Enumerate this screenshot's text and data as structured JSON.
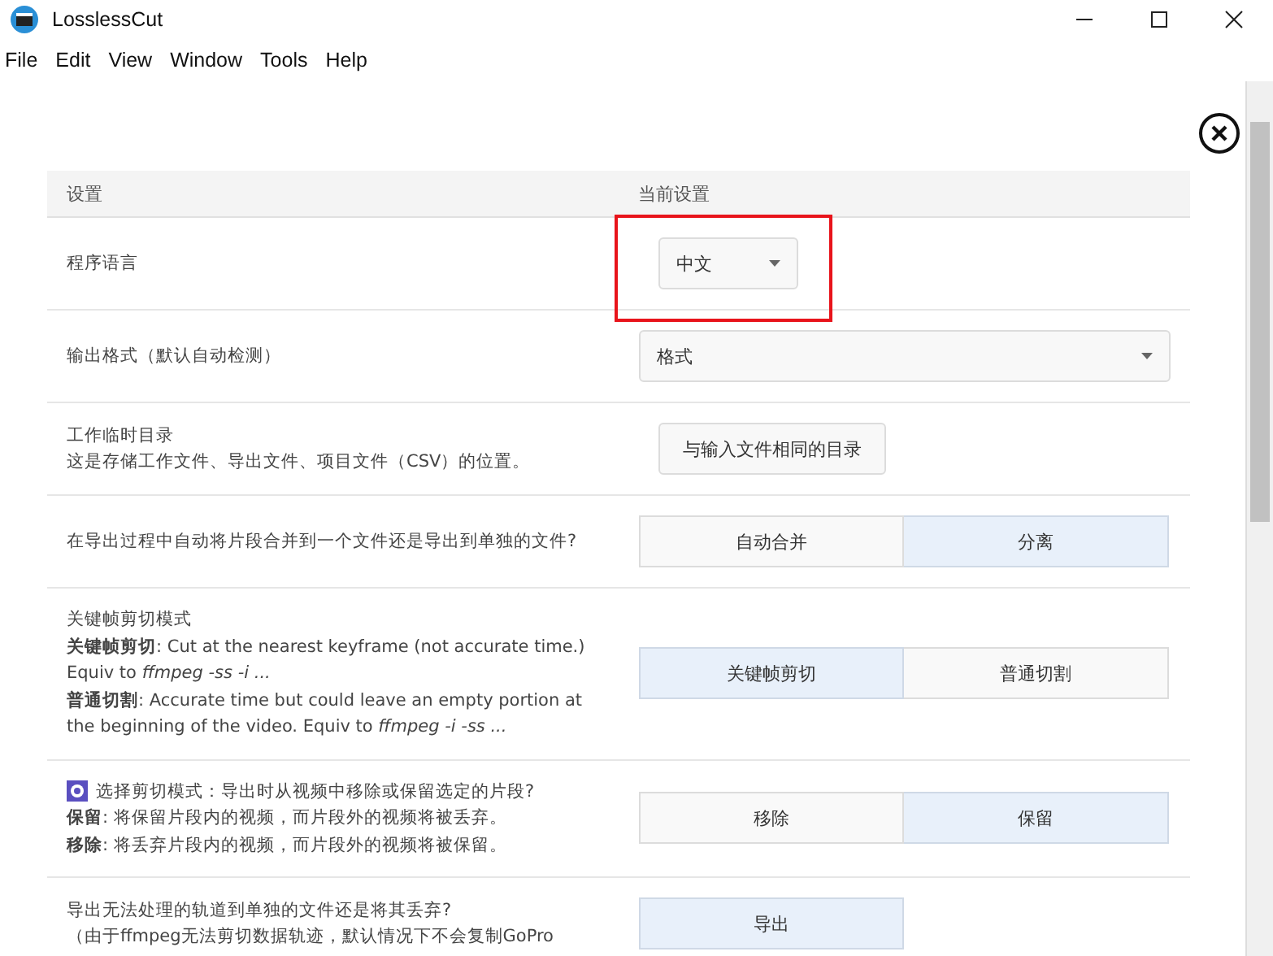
{
  "window": {
    "title": "LosslessCut"
  },
  "menu": [
    "File",
    "Edit",
    "View",
    "Window",
    "Tools",
    "Help"
  ],
  "settings": {
    "columns": [
      "设置",
      "当前设置"
    ],
    "rows": [
      {
        "kind": "select",
        "lines": [
          "程序语言"
        ],
        "value": "中文",
        "full_width": false,
        "highlighted": true
      },
      {
        "kind": "select",
        "lines": [
          "输出格式（默认自动检测）"
        ],
        "value": "格式",
        "full_width": true
      },
      {
        "kind": "button",
        "lines": [
          "工作临时目录",
          "这是存储工作文件、导出文件、项目文件（CSV）的位置。"
        ],
        "value": "与输入文件相同的目录"
      },
      {
        "kind": "segmented",
        "lines": [
          "在导出过程中自动将片段合并到一个文件还是导出到单独的文件?"
        ],
        "options": [
          {
            "label": "自动合并",
            "selected": false
          },
          {
            "label": "分离",
            "selected": true
          }
        ]
      },
      {
        "kind": "segmented",
        "lines": [
          "关键帧剪切模式",
          "**关键帧剪切**: Cut at the nearest keyframe (not accurate time.) Equiv to *ffmpeg -ss -i ...*",
          "**普通切割**: Accurate time but could leave an empty portion at the beginning of the video. Equiv to *ffmpeg -i -ss ...*"
        ],
        "options": [
          {
            "label": "关键帧剪切",
            "selected": true
          },
          {
            "label": "普通切割",
            "selected": false
          }
        ]
      },
      {
        "kind": "segmented",
        "lead_icon": true,
        "lines": [
          "选择剪切模式：导出时从视频中移除或保留选定的片段?",
          "**保留**: 将保留片段内的视频，而片段外的视频将被丢弃。",
          "**移除**: 将丢弃片段内的视频，而片段外的视频将被保留。"
        ],
        "options": [
          {
            "label": "移除",
            "selected": false
          },
          {
            "label": "保留",
            "selected": true
          }
        ]
      },
      {
        "kind": "segmented",
        "lines": [
          "导出无法处理的轨道到单独的文件还是将其丢弃?",
          "（由于ffmpeg无法剪切数据轨迹，默认情况下不会复制GoPro"
        ],
        "options": [
          {
            "label": "导出",
            "selected": true
          }
        ]
      }
    ]
  }
}
